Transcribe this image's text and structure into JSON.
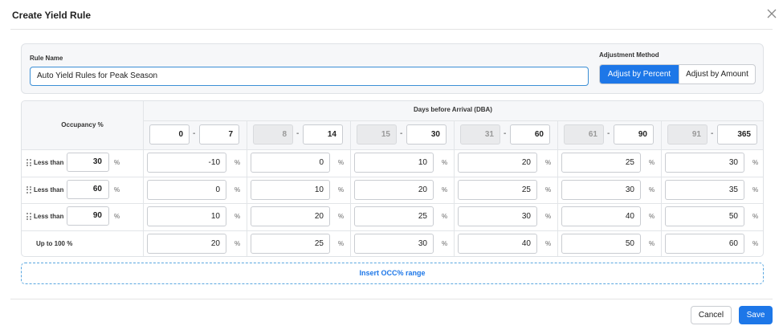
{
  "dialog": {
    "title": "Create Yield Rule"
  },
  "rule_name": {
    "label": "Rule Name",
    "value": "Auto Yield Rules for Peak Season"
  },
  "adjustment": {
    "label": "Adjustment Method",
    "options": [
      "Adjust by Percent",
      "Adjust by Amount"
    ],
    "selected": "Adjust by Percent"
  },
  "table": {
    "occupancy_header": "Occupancy %",
    "dba_header": "Days before Arrival (DBA)",
    "dba_ranges": [
      {
        "from": "0",
        "to": "7",
        "from_disabled": false
      },
      {
        "from": "8",
        "to": "14",
        "from_disabled": true
      },
      {
        "from": "15",
        "to": "30",
        "from_disabled": true
      },
      {
        "from": "31",
        "to": "60",
        "from_disabled": true
      },
      {
        "from": "61",
        "to": "90",
        "from_disabled": true
      },
      {
        "from": "91",
        "to": "365",
        "from_disabled": true
      }
    ],
    "rows": [
      {
        "label": "Less than",
        "threshold": "30",
        "unit": "%",
        "values": [
          "-10",
          "0",
          "10",
          "20",
          "25",
          "30"
        ]
      },
      {
        "label": "Less than",
        "threshold": "60",
        "unit": "%",
        "values": [
          "0",
          "10",
          "20",
          "25",
          "30",
          "35"
        ]
      },
      {
        "label": "Less than",
        "threshold": "90",
        "unit": "%",
        "values": [
          "10",
          "20",
          "25",
          "30",
          "40",
          "50"
        ]
      },
      {
        "label": "Up to 100 %",
        "values": [
          "20",
          "25",
          "30",
          "40",
          "50",
          "60"
        ]
      }
    ],
    "dash": "-",
    "value_unit": "%"
  },
  "insert_label": "Insert OCC% range",
  "footer": {
    "cancel": "Cancel",
    "save": "Save"
  },
  "colors": {
    "primary": "#1d77e8",
    "focus_border": "#3b8fd6"
  },
  "icons": {
    "close": "close-icon",
    "drag": "drag-handle-icon"
  }
}
